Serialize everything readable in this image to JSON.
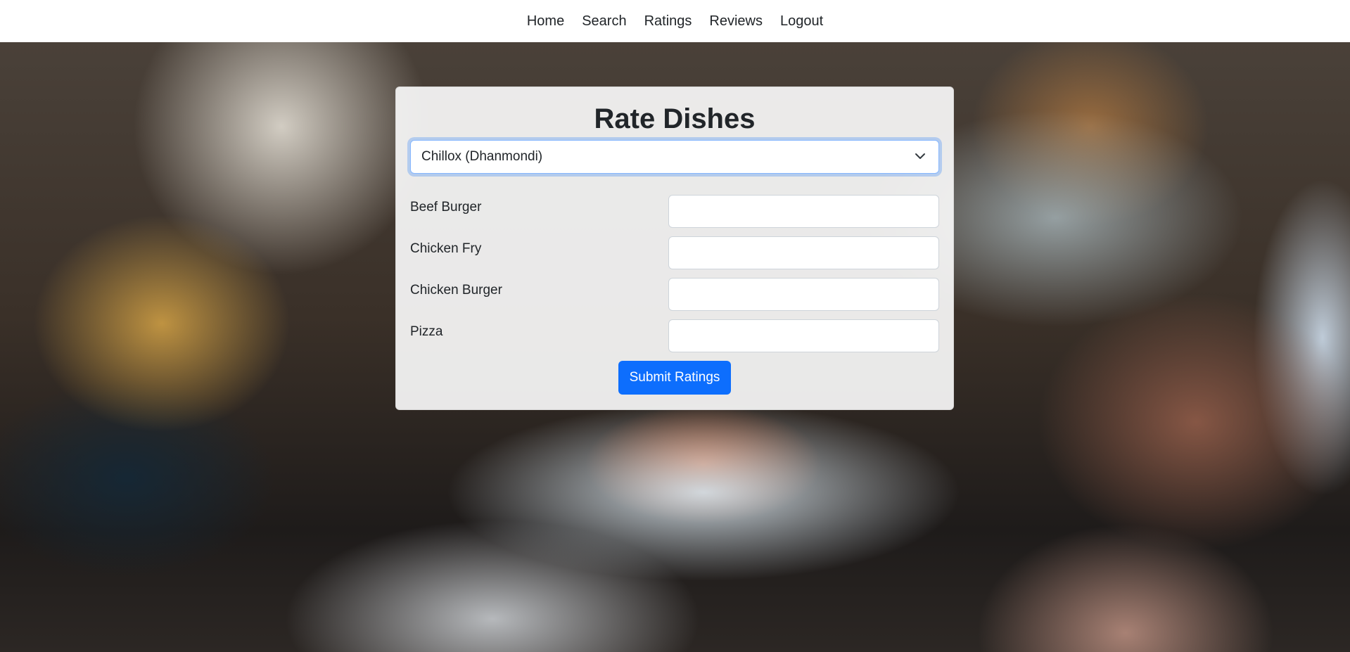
{
  "nav": {
    "items": [
      {
        "label": "Home"
      },
      {
        "label": "Search"
      },
      {
        "label": "Ratings"
      },
      {
        "label": "Reviews"
      },
      {
        "label": "Logout"
      }
    ]
  },
  "form": {
    "title": "Rate Dishes",
    "restaurant_select": {
      "selected": "Chillox (Dhanmondi)"
    },
    "dishes": [
      {
        "label": "Beef Burger",
        "value": ""
      },
      {
        "label": "Chicken Fry",
        "value": ""
      },
      {
        "label": "Chicken Burger",
        "value": ""
      },
      {
        "label": "Pizza",
        "value": ""
      }
    ],
    "submit_label": "Submit Ratings"
  },
  "colors": {
    "primary": "#0d6efd",
    "focus_ring": "#86b7fe",
    "text": "#212529"
  },
  "icons": {
    "select_arrow": "chevron-down-icon"
  }
}
